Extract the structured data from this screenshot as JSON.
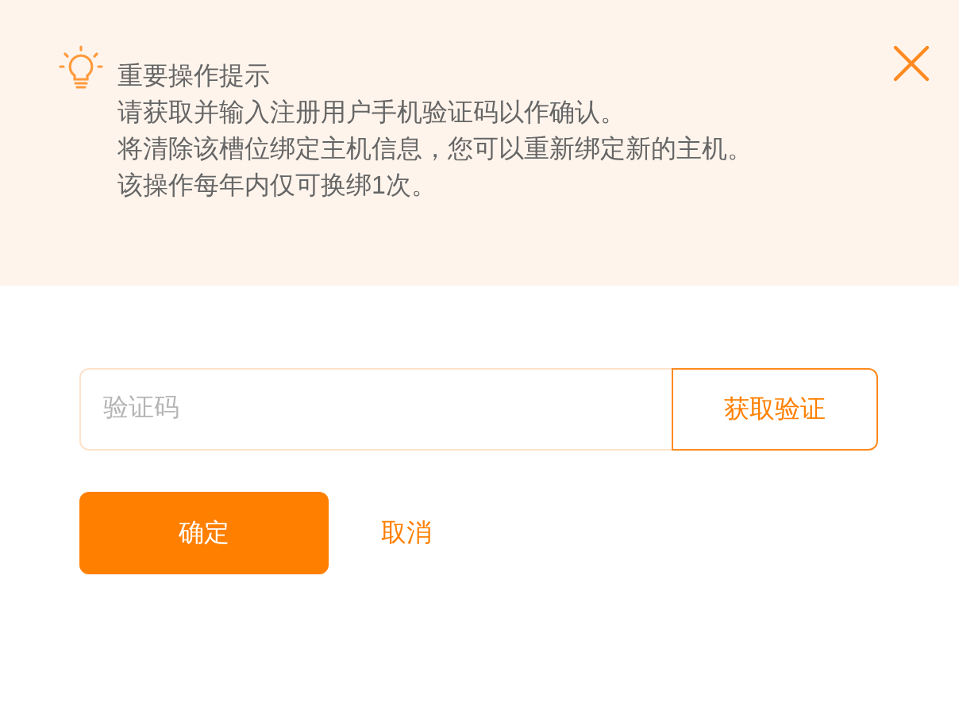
{
  "notice": {
    "title": "重要操作提示",
    "lines": [
      "请获取并输入注册用户手机验证码以作确认。",
      "将清除该槽位绑定主机信息，您可以重新绑定新的主机。",
      "该操作每年内仅可换绑1次。"
    ]
  },
  "code_field": {
    "placeholder": "验证码"
  },
  "get_code_button": "获取验证",
  "buttons": {
    "confirm": "确定",
    "cancel": "取消"
  }
}
